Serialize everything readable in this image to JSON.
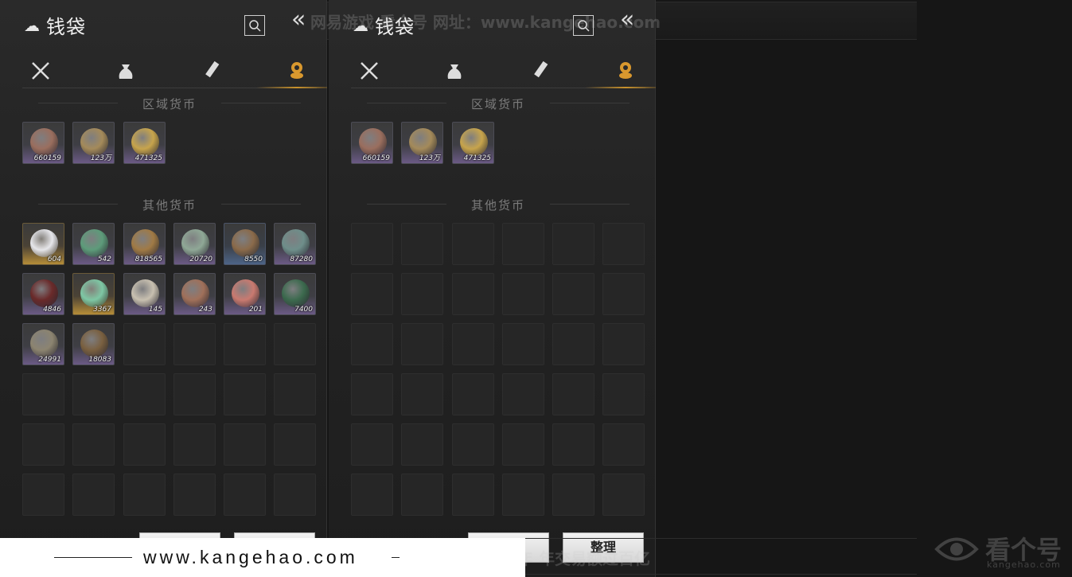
{
  "panels": [
    {
      "title": "钱袋",
      "section_regional": "区域货币",
      "section_other": "其他货币",
      "regional": [
        {
          "name": "copper-coin",
          "count": "660159",
          "rarity": "purple",
          "color": "#9a6e5e"
        },
        {
          "name": "bronze-coin",
          "count": "123万",
          "rarity": "purple",
          "color": "#a48a5a"
        },
        {
          "name": "gold-coin",
          "count": "471325",
          "rarity": "purple",
          "color": "#c7a44c"
        }
      ],
      "other": [
        {
          "name": "pearl",
          "count": "604",
          "rarity": "gold",
          "color": "#e6e6ea"
        },
        {
          "name": "jade-note",
          "count": "542",
          "rarity": "purple",
          "color": "#5d9b7a"
        },
        {
          "name": "copper-coin-string",
          "count": "818565",
          "rarity": "purple",
          "color": "#a07a45"
        },
        {
          "name": "jade-ruyi",
          "count": "20720",
          "rarity": "purple",
          "color": "#8fa896"
        },
        {
          "name": "ancient-bronze-coin",
          "count": "8550",
          "rarity": "blue",
          "color": "#8a6a4a"
        },
        {
          "name": "jade-fish",
          "count": "87280",
          "rarity": "purple",
          "color": "#6e8e8a"
        },
        {
          "name": "red-arrow-token",
          "count": "4846",
          "rarity": "purple",
          "color": "#6a2a2a"
        },
        {
          "name": "jade-bi-disc",
          "count": "3367",
          "rarity": "gold",
          "color": "#7ec7a4"
        },
        {
          "name": "bamboo-tally",
          "count": "145",
          "rarity": "purple",
          "color": "#c8c0b0"
        },
        {
          "name": "carved-tablet",
          "count": "243",
          "rarity": "purple",
          "color": "#a0705a"
        },
        {
          "name": "red-jade",
          "count": "201",
          "rarity": "purple",
          "color": "#c97a70"
        },
        {
          "name": "green-arrow-token",
          "count": "7400",
          "rarity": "purple",
          "color": "#3c6a4e"
        },
        {
          "name": "bronze-key",
          "count": "24991",
          "rarity": "purple",
          "color": "#8c8470"
        },
        {
          "name": "bronze-bell",
          "count": "18083",
          "rarity": "purple",
          "color": "#7a6040"
        }
      ]
    },
    {
      "title": "钱袋",
      "section_regional": "区域货币",
      "section_other": "其他货币",
      "regional": [
        {
          "name": "copper-coin",
          "count": "660159",
          "rarity": "purple",
          "color": "#9a6e5e"
        },
        {
          "name": "bronze-coin",
          "count": "123万",
          "rarity": "purple",
          "color": "#a48a5a"
        },
        {
          "name": "gold-coin",
          "count": "471325",
          "rarity": "purple",
          "color": "#c7a44c"
        }
      ],
      "other": []
    }
  ],
  "tabs": [
    "weapons-tab",
    "bag-tab",
    "scroll-tab",
    "currency-tab"
  ],
  "buttons": {
    "sort_label": "整理",
    "left_label": ""
  },
  "watermark": {
    "top": "网易游戏 看个号  网址：www.kangehao.com",
    "bottom": "看个号专业网易游戏八年    年交易额过百亿",
    "footer_url": "www.kangehao.com",
    "logo_text": "看个号",
    "logo_sub": "kangehao.com"
  },
  "colors": {
    "accent_gold": "#c9922c",
    "rarity_purple": "#6b5a85",
    "rarity_gold": "#b58d38",
    "rarity_blue": "#4d6487"
  }
}
